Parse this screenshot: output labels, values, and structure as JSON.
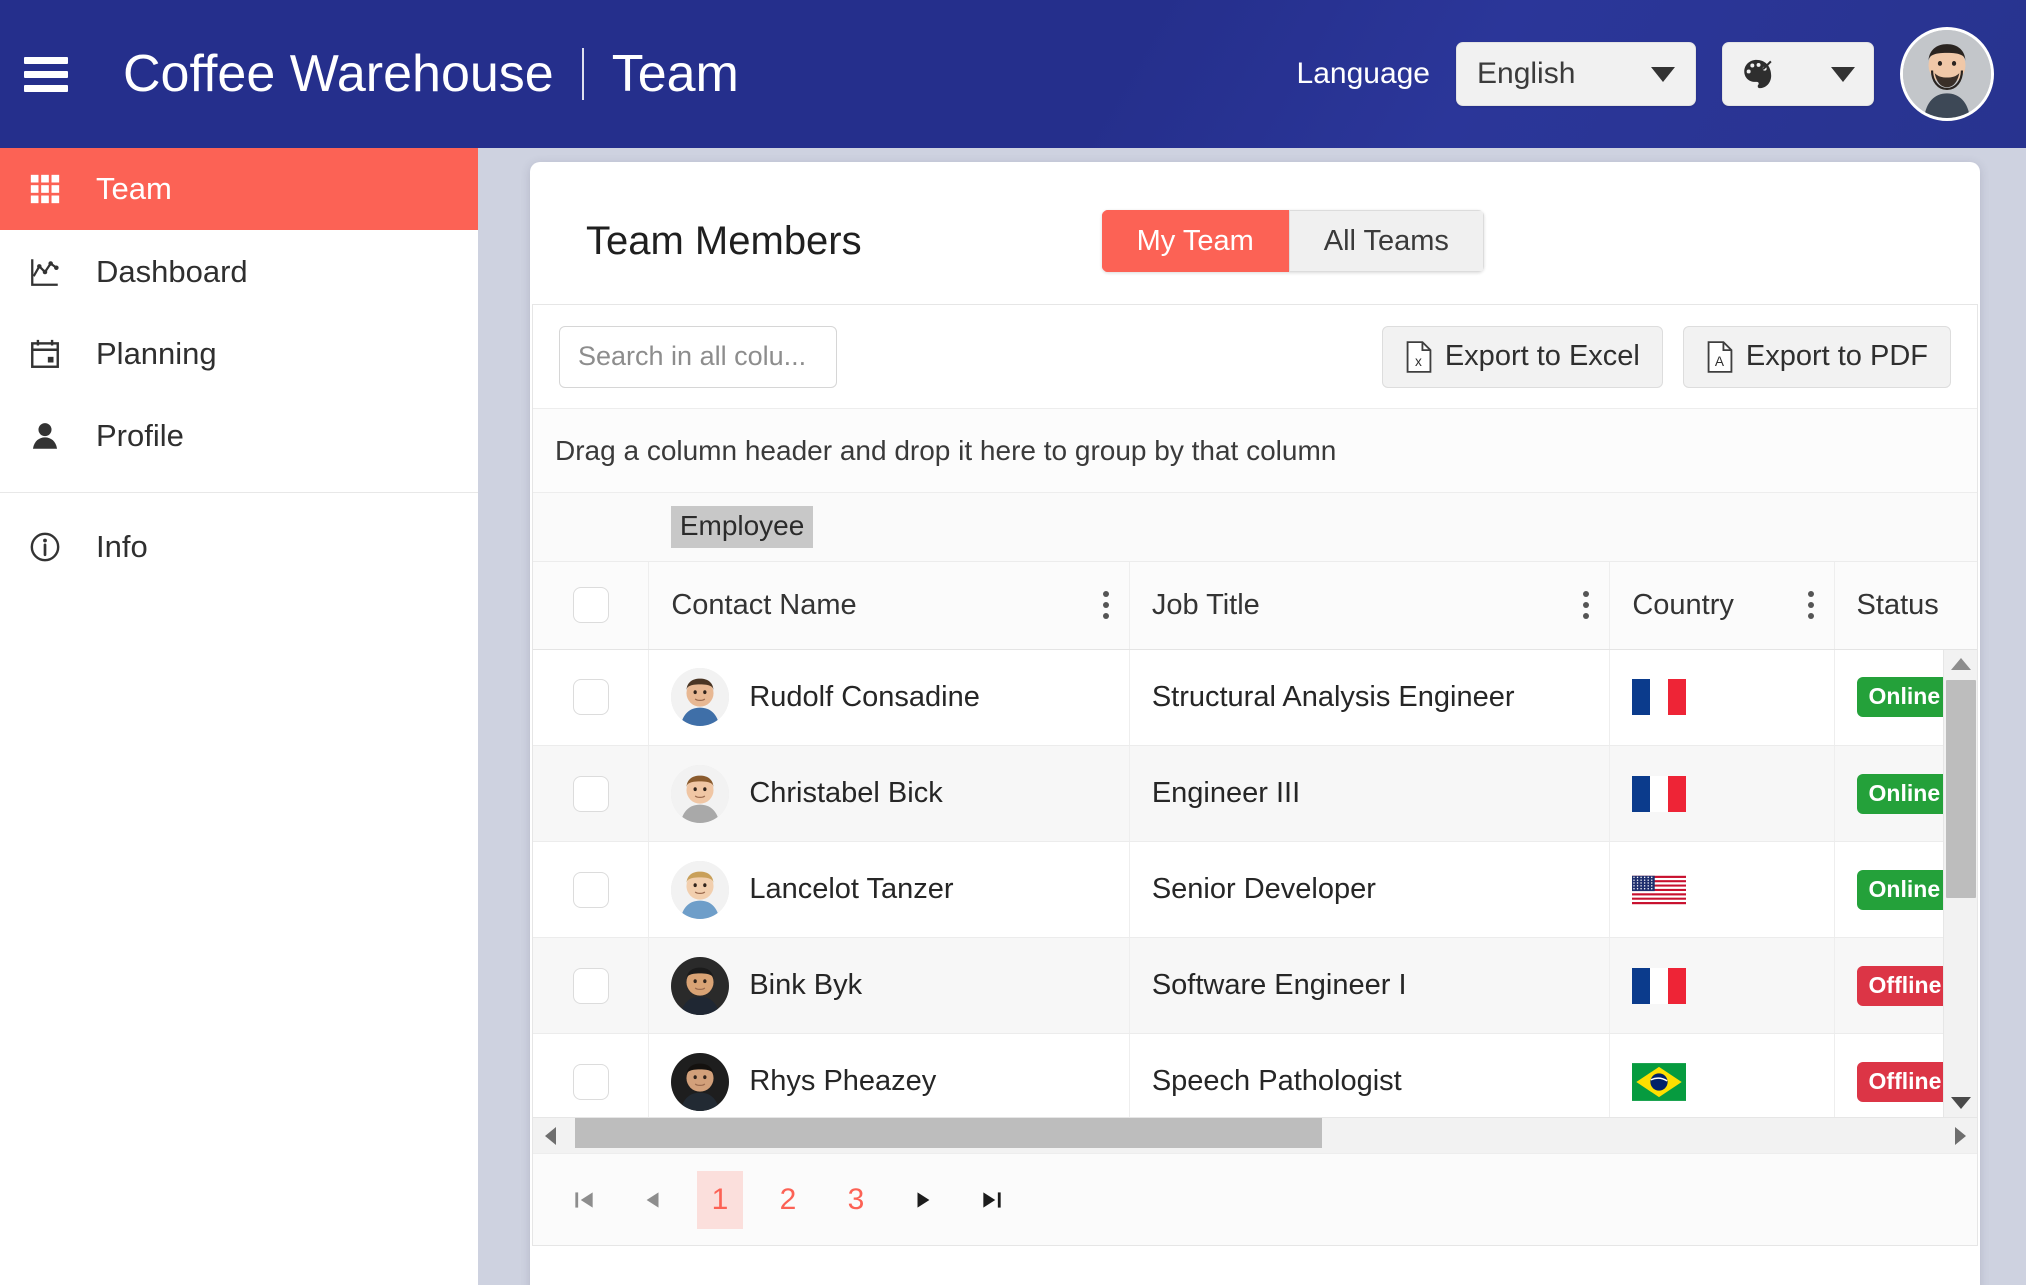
{
  "header": {
    "menu_icon": "hamburger-icon",
    "brand": "Coffee Warehouse",
    "page": "Team",
    "language_label": "Language",
    "language_value": "English",
    "theme_icon": "palette-icon",
    "avatar_icon": "user-avatar"
  },
  "sidebar": {
    "items": [
      {
        "label": "Team",
        "icon": "grid-icon",
        "active": true
      },
      {
        "label": "Dashboard",
        "icon": "chart-icon",
        "active": false
      },
      {
        "label": "Planning",
        "icon": "calendar-icon",
        "active": false
      },
      {
        "label": "Profile",
        "icon": "person-icon",
        "active": false
      },
      {
        "label": "Info",
        "icon": "info-circle-icon",
        "active": false
      }
    ]
  },
  "main": {
    "title": "Team Members",
    "toggle": {
      "left": "My Team",
      "right": "All Teams",
      "selected": "My Team"
    },
    "search_placeholder": "Search in all colu...",
    "export_excel": "Export to Excel",
    "export_pdf": "Export to PDF",
    "group_hint": "Drag a column header and drop it here to group by that column",
    "band_label": "Employee",
    "columns": [
      "Contact Name",
      "Job Title",
      "Country",
      "Status"
    ],
    "rows": [
      {
        "name": "Rudolf Consadine",
        "job": "Structural Analysis Engineer",
        "country": "France",
        "flag": "fr",
        "status": "Online"
      },
      {
        "name": "Christabel Bick",
        "job": "Engineer III",
        "country": "France",
        "flag": "fr",
        "status": "Online"
      },
      {
        "name": "Lancelot Tanzer",
        "job": "Senior Developer",
        "country": "United States",
        "flag": "us",
        "status": "Online"
      },
      {
        "name": "Bink Byk",
        "job": "Software Engineer I",
        "country": "France",
        "flag": "fr",
        "status": "Offline"
      },
      {
        "name": "Rhys Pheazey",
        "job": "Speech Pathologist",
        "country": "Brazil",
        "flag": "br",
        "status": "Offline"
      }
    ],
    "pager": {
      "pages": [
        "1",
        "2",
        "3"
      ],
      "current": "1"
    }
  },
  "colors": {
    "accent": "#fc6255",
    "header_blue": "#252f8c",
    "online": "#24a13a",
    "offline": "#dc3546",
    "page_bg": "#ced2e0"
  }
}
